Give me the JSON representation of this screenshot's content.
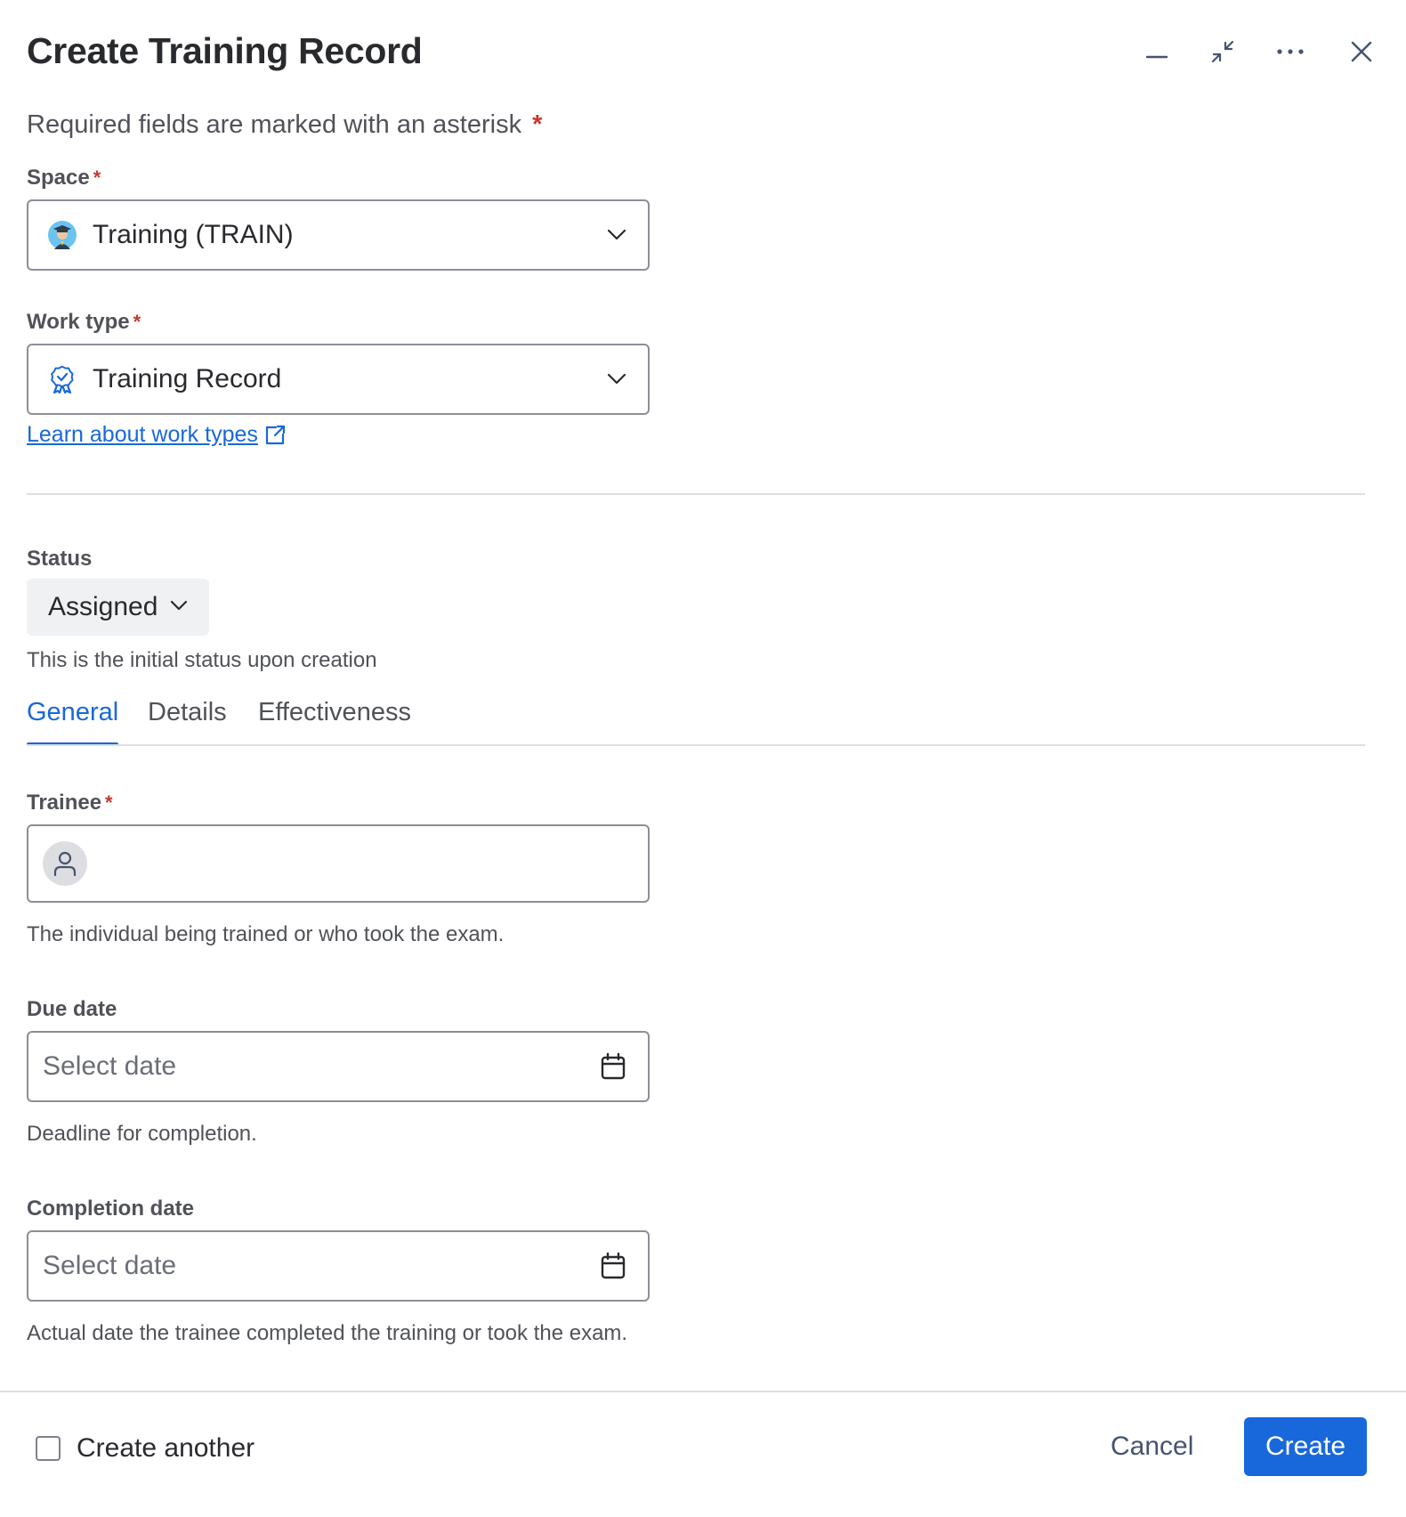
{
  "dialog": {
    "title": "Create Training Record",
    "header_actions": [
      "minimize-icon",
      "collapse-icon",
      "more-icon",
      "close-icon"
    ]
  },
  "required_note": {
    "text": "Required fields are marked with an asterisk",
    "asterisk": "*"
  },
  "space": {
    "label": "Space",
    "asterisk": "*",
    "value": "Training (TRAIN)",
    "icon": "graduate-avatar-icon"
  },
  "work_type": {
    "label": "Work type",
    "asterisk": "*",
    "value": "Training Record",
    "icon": "badge-icon",
    "link": "Learn about work types"
  },
  "status": {
    "label": "Status",
    "value": "Assigned",
    "helper": "This is the initial status upon creation"
  },
  "tabs": [
    {
      "label": "General",
      "active": true
    },
    {
      "label": "Details",
      "active": false
    },
    {
      "label": "Effectiveness",
      "active": false
    }
  ],
  "trainee": {
    "label": "Trainee",
    "asterisk": "*",
    "helper": "The individual being trained or who took the exam."
  },
  "due_date": {
    "label": "Due date",
    "placeholder": "Select date",
    "helper": "Deadline for completion."
  },
  "completion_date": {
    "label": "Completion date",
    "placeholder": "Select date",
    "helper": "Actual date the trainee completed the training or took the exam."
  },
  "footer": {
    "create_another": "Create another",
    "create_another_checked": false,
    "cancel": "Cancel",
    "create": "Create"
  },
  "colors": {
    "accent": "#1868db",
    "required": "#c9372c",
    "border": "#8c8f97",
    "divider": "#dcdfe4"
  }
}
